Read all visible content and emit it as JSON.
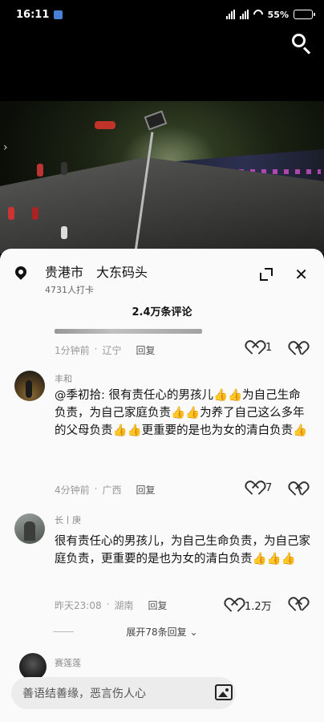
{
  "status_bar": {
    "time": "16:11",
    "battery": "55%"
  },
  "location": {
    "city": "贵港市",
    "place": "大东码头",
    "visitors": "4731人打卡"
  },
  "comments_header": {
    "count": "2.4万条评论"
  },
  "partial_comment": {
    "time": "1分钟前",
    "region": "辽宁",
    "reply": "回复",
    "likes": "1"
  },
  "comments": [
    {
      "user": "丰和",
      "text": "@季初拾: 很有责任心的男孩儿👍👍为自己生命负责，为自己家庭负责👍👍为养了自己这么多年的父母负责👍👍更重要的是也为女的清白负责👍",
      "time": "4分钟前",
      "region": "广西",
      "reply": "回复",
      "likes": "7"
    },
    {
      "user": "长丨庚",
      "text": "很有责任心的男孩儿，为自己生命负责，为自己家庭负责，更重要的是也为女的清白负责👍👍👍",
      "time": "昨天23:08",
      "region": "湖南",
      "reply": "回复",
      "likes": "1.2万"
    }
  ],
  "expand_replies": "展开78条回复",
  "partial_next_user": "赛莲莲",
  "input": {
    "placeholder": "善语结善缘，恶言伤人心"
  }
}
